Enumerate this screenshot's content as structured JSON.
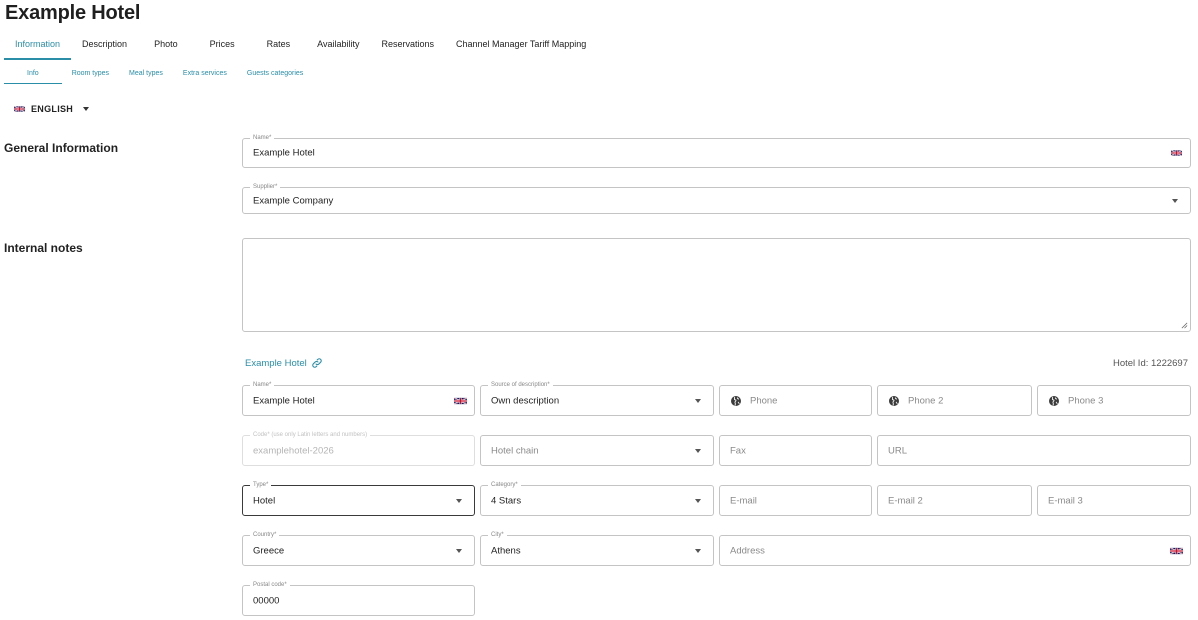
{
  "header": {
    "title": "Example Hotel"
  },
  "tabs": [
    {
      "label": "Information",
      "active": true
    },
    {
      "label": "Description"
    },
    {
      "label": "Photo"
    },
    {
      "label": "Prices"
    },
    {
      "label": "Rates"
    },
    {
      "label": "Availability"
    },
    {
      "label": "Reservations"
    },
    {
      "label": "Channel Manager Tariff Mapping"
    }
  ],
  "subtabs": [
    {
      "label": "Info",
      "active": true
    },
    {
      "label": "Room types"
    },
    {
      "label": "Meal types"
    },
    {
      "label": "Extra services"
    },
    {
      "label": "Guests categories"
    }
  ],
  "language": {
    "label": "ENGLISH",
    "icon": "uk-flag-icon"
  },
  "sections": {
    "general": "General Information",
    "notes": "Internal notes"
  },
  "general": {
    "name": {
      "label": "Name*",
      "value": "Example Hotel"
    },
    "supplier": {
      "label": "Supplier*",
      "value": "Example Company"
    }
  },
  "internal_notes": {
    "value": ""
  },
  "hotel_link": {
    "label": "Example Hotel",
    "icon": "link-icon"
  },
  "hotel_id": "Hotel Id: 1222697",
  "details": {
    "name": {
      "label": "Name*",
      "value": "Example Hotel"
    },
    "source": {
      "label": "Source of description*",
      "value": "Own description"
    },
    "phone": {
      "placeholder": "Phone"
    },
    "phone2": {
      "placeholder": "Phone 2"
    },
    "phone3": {
      "placeholder": "Phone 3"
    },
    "code": {
      "label": "Code* (use only Latin letters and numbers)",
      "value": "examplehotel-2026"
    },
    "hotel_chain": {
      "placeholder": "Hotel chain"
    },
    "fax": {
      "placeholder": "Fax"
    },
    "url": {
      "placeholder": "URL"
    },
    "type": {
      "label": "Type*",
      "value": "Hotel"
    },
    "category": {
      "label": "Category*",
      "value": "4 Stars"
    },
    "email": {
      "placeholder": "E-mail"
    },
    "email2": {
      "placeholder": "E-mail 2"
    },
    "email3": {
      "placeholder": "E-mail 3"
    },
    "country": {
      "label": "Country*",
      "value": "Greece"
    },
    "city": {
      "label": "City*",
      "value": "Athens"
    },
    "address": {
      "placeholder": "Address"
    },
    "postal": {
      "label": "Postal code*",
      "value": "00000"
    }
  },
  "colors": {
    "accent": "#2a8ea8",
    "border": "#c4c4c4",
    "text": "#222222"
  }
}
